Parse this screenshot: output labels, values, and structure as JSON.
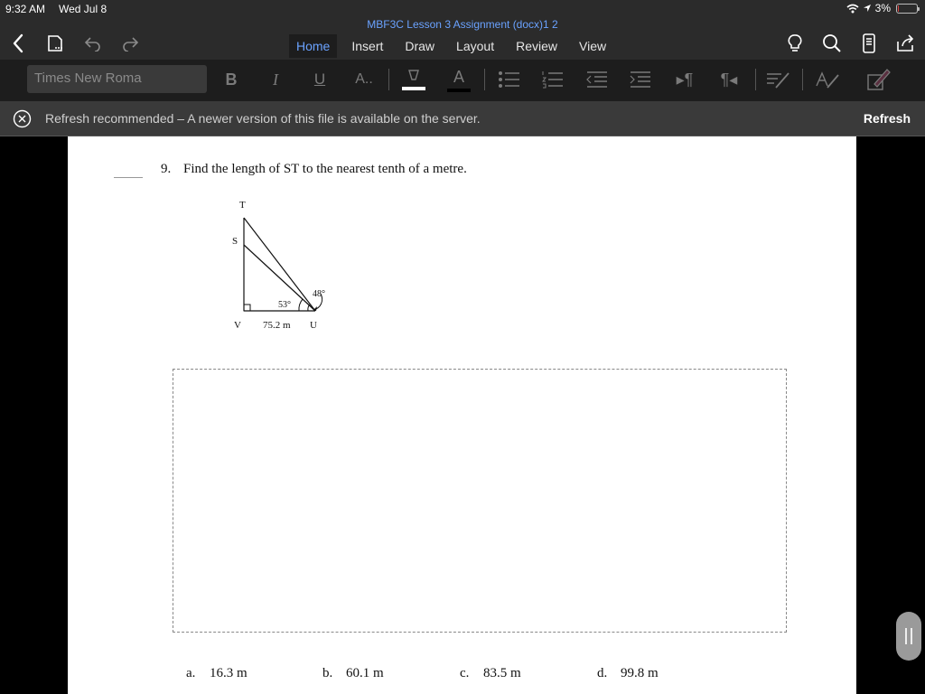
{
  "status_bar": {
    "time": "9:32 AM",
    "date": "Wed Jul 8",
    "battery": "3%",
    "battery_level": 0.03
  },
  "document_title": "MBF3C Lesson 3 Assignment (docx)1 2",
  "nav": {
    "icons": [
      "back-chevron-icon",
      "file-icon",
      "undo-icon",
      "redo-icon",
      "lightbulb-icon",
      "search-icon",
      "phone-view-icon",
      "share-icon"
    ],
    "tabs": [
      {
        "label": "Home",
        "active": true
      },
      {
        "label": "Insert",
        "active": false
      },
      {
        "label": "Draw",
        "active": false
      },
      {
        "label": "Layout",
        "active": false
      },
      {
        "label": "Review",
        "active": false
      },
      {
        "label": "View",
        "active": false
      }
    ]
  },
  "ribbon": {
    "font_name": "Times New Roma",
    "bold": "B",
    "italic": "I",
    "underline": "U",
    "font_size": "A..",
    "font_color": "A"
  },
  "infobar": {
    "message": "Refresh recommended – A newer version of this file is available on the server.",
    "action": "Refresh"
  },
  "question": {
    "number": "9.",
    "text": "Find the length of ST to the nearest tenth of a metre.",
    "figure": {
      "label_T": "T",
      "label_S": "S",
      "label_V": "V",
      "label_U": "U",
      "base": "75.2 m",
      "angle_small": "53°",
      "angle_large": "48°"
    },
    "choices": [
      {
        "letter": "a.",
        "value": "16.3 m"
      },
      {
        "letter": "b.",
        "value": "60.1 m"
      },
      {
        "letter": "c.",
        "value": "83.5 m"
      },
      {
        "letter": "d.",
        "value": "99.8 m"
      }
    ]
  },
  "colors": {
    "accent": "#6aa2ff",
    "chrome": "#2b2b2b",
    "ribbon": "#1d1d1d",
    "infobar": "#3a3a3a"
  }
}
